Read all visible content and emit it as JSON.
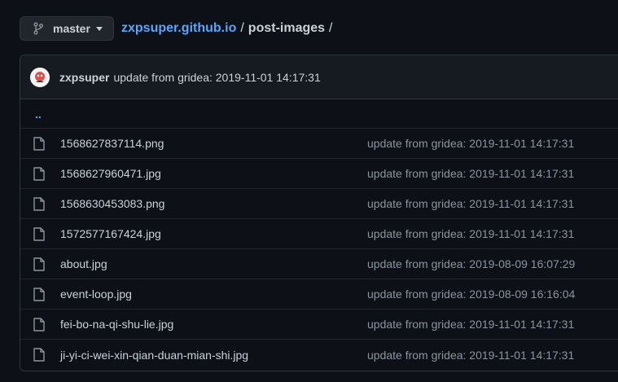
{
  "header": {
    "branch_label": "master",
    "repo_name": "zxpsuper.github.io",
    "separator": "/",
    "folder_name": "post-images",
    "trailing_separator": "/"
  },
  "last_commit": {
    "author": "zxpsuper",
    "message": "update from gridea: 2019-11-01 14:17:31"
  },
  "parent_dir_label": "..",
  "files": [
    {
      "name": "1568627837114.png",
      "commit": "update from gridea: 2019-11-01 14:17:31"
    },
    {
      "name": "1568627960471.jpg",
      "commit": "update from gridea: 2019-11-01 14:17:31"
    },
    {
      "name": "1568630453083.png",
      "commit": "update from gridea: 2019-11-01 14:17:31"
    },
    {
      "name": "1572577167424.jpg",
      "commit": "update from gridea: 2019-11-01 14:17:31"
    },
    {
      "name": "about.jpg",
      "commit": "update from gridea: 2019-08-09 16:07:29"
    },
    {
      "name": "event-loop.jpg",
      "commit": "update from gridea: 2019-08-09 16:16:04"
    },
    {
      "name": "fei-bo-na-qi-shu-lie.jpg",
      "commit": "update from gridea: 2019-11-01 14:17:31"
    },
    {
      "name": "ji-yi-ci-wei-xin-qian-duan-mian-shi.jpg",
      "commit": "update from gridea: 2019-11-01 14:17:31"
    }
  ],
  "colors": {
    "background": "#0d1117",
    "link": "#58a6ff",
    "text": "#c9d1d9",
    "muted": "#8b949e",
    "border": "#30363d"
  },
  "icons": {
    "branch": "git-branch-icon",
    "caret": "caret-down-icon",
    "file": "file-icon"
  }
}
